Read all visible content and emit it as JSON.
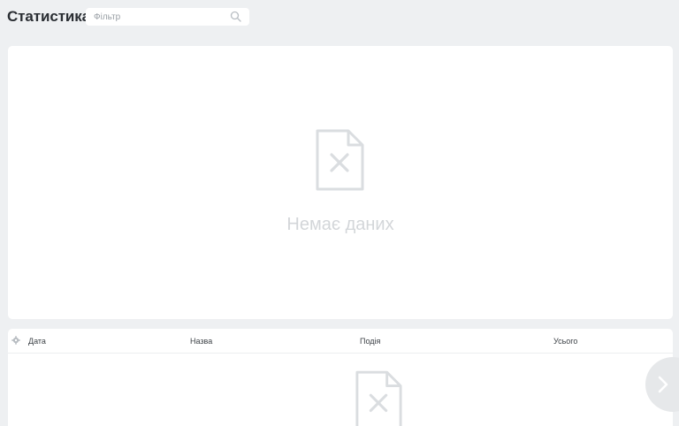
{
  "header": {
    "title": "Статистика",
    "filter_placeholder": "Фільтр"
  },
  "chart_panel": {
    "empty_message": "Немає даних"
  },
  "table": {
    "columns": [
      "Дата",
      "Назва",
      "Подія",
      "Усього"
    ],
    "rows": []
  },
  "icons": {
    "search": "search-icon",
    "no_data": "file-x-icon",
    "settings": "gear-icon",
    "next": "chevron-right-icon"
  },
  "colors": {
    "background": "#eef0f2",
    "card": "#ffffff",
    "empty_text": "#d3d6d9",
    "icon_gray": "#dadde0"
  }
}
